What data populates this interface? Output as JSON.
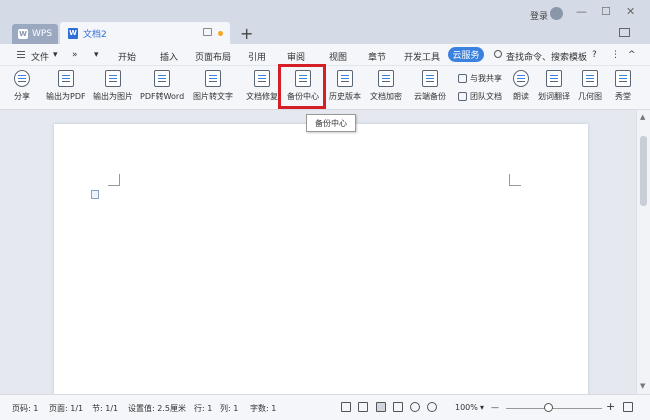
{
  "titlebar": {
    "wps_tab": "WPS",
    "wps_logo": "W",
    "doc_tab": "文档2",
    "doc_icon": "W",
    "add_tab": "+",
    "login": "登录",
    "minimize": "—",
    "restore": "☐",
    "close": "✕"
  },
  "menubar": {
    "file": "文件",
    "file_arrow": "▾",
    "more": "»",
    "more_arrow": "▾",
    "items": [
      "开始",
      "插入",
      "页面布局",
      "引用",
      "审阅",
      "视图",
      "章节",
      "开发工具"
    ],
    "cloud": "云服务",
    "search": "查找命令、搜索模板",
    "help": "?",
    "more_options": "⋮",
    "collapse": "^"
  },
  "ribbon": {
    "buttons": [
      "分享",
      "输出为PDF",
      "输出为图片",
      "PDF转Word",
      "图片转文字",
      "文档修复",
      "备份中心",
      "历史版本",
      "文档加密",
      "云端备份",
      "朗读",
      "划词翻译",
      "几何图",
      "秀堂"
    ],
    "share_with_me": "与我共享",
    "team_docs": "团队文档"
  },
  "tooltip": "备份中心",
  "status": {
    "page_num": "页码: 1",
    "pages": "页面: 1/1",
    "section": "节: 1/1",
    "setting": "设置值: 2.5厘米",
    "row": "行: 1",
    "col": "列: 1",
    "words": "字数: 1",
    "zoom": "100%",
    "zoom_minus": "—",
    "zoom_plus": "+",
    "zoom_level_fraction": 0.44
  }
}
